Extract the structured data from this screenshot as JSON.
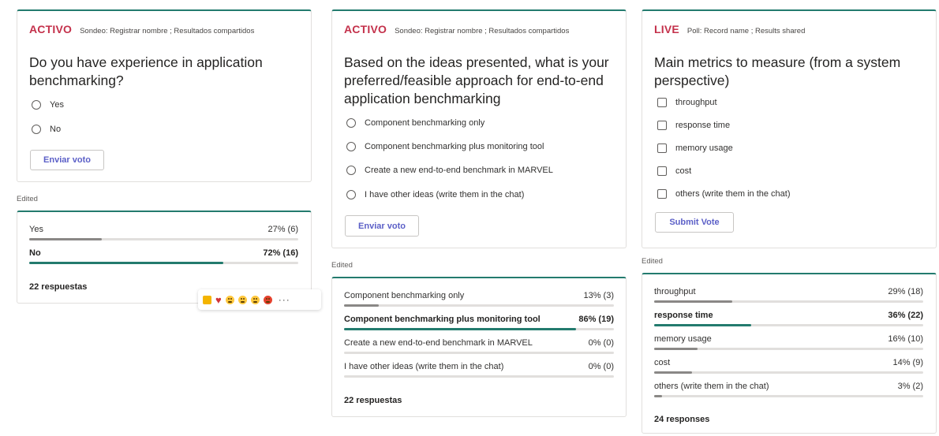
{
  "colors": {
    "live_status": "#c4314b",
    "accent_teal": "#237b6e",
    "button_text": "#5b5fc7",
    "bar_other": "#8a8886"
  },
  "poll1": {
    "status": "ACTIVO",
    "subtitle": "Sondeo: Registrar nombre ; Resultados compartidos",
    "question": "Do you have experience in application benchmarking?",
    "options": [
      "Yes",
      "No"
    ],
    "submit_label": "Enviar voto",
    "edited_label": "Edited",
    "results": [
      {
        "label": "Yes",
        "pct_text": "27% (6)",
        "fraction": 0.27,
        "leading": false
      },
      {
        "label": "No",
        "pct_text": "72% (16)",
        "fraction": 0.72,
        "leading": true
      }
    ],
    "responses": "22 respuestas",
    "reactions": [
      "like-icon",
      "heart-icon",
      "laugh-icon",
      "surprised-icon",
      "sad-icon",
      "angry-icon",
      "more-options-icon"
    ],
    "more_glyph": "···"
  },
  "poll2": {
    "status": "ACTIVO",
    "subtitle": "Sondeo: Registrar nombre ; Resultados compartidos",
    "question": "Based on the ideas presented, what is your preferred/feasible approach for end-to-end application benchmarking",
    "options": [
      "Component benchmarking only",
      "Component benchmarking plus monitoring tool",
      "Create a new end-to-end benchmark in MARVEL",
      "I have other ideas (write them in the chat)"
    ],
    "submit_label": "Enviar voto",
    "edited_label": "Edited",
    "results": [
      {
        "label": "Component benchmarking only",
        "pct_text": "13% (3)",
        "fraction": 0.13,
        "leading": false
      },
      {
        "label": "Component benchmarking plus monitoring tool",
        "pct_text": "86% (19)",
        "fraction": 0.86,
        "leading": true
      },
      {
        "label": "Create a new end-to-end benchmark in MARVEL",
        "pct_text": "0% (0)",
        "fraction": 0.0,
        "leading": false
      },
      {
        "label": "I have other ideas (write them in the chat)",
        "pct_text": "0% (0)",
        "fraction": 0.0,
        "leading": false
      }
    ],
    "responses": "22 respuestas"
  },
  "poll3": {
    "status": "LIVE",
    "subtitle": "Poll: Record name ; Results shared",
    "question": "Main metrics to measure (from a system perspective)",
    "options": [
      "throughput",
      "response time",
      "memory usage",
      "cost",
      "others (write them in the chat)"
    ],
    "submit_label": "Submit Vote",
    "edited_label": "Edited",
    "results": [
      {
        "label": "throughput",
        "pct_text": "29% (18)",
        "fraction": 0.29,
        "leading": false
      },
      {
        "label": "response time",
        "pct_text": "36% (22)",
        "fraction": 0.36,
        "leading": true
      },
      {
        "label": "memory usage",
        "pct_text": "16% (10)",
        "fraction": 0.16,
        "leading": false
      },
      {
        "label": "cost",
        "pct_text": "14% (9)",
        "fraction": 0.14,
        "leading": false
      },
      {
        "label": "others (write them in the chat)",
        "pct_text": "3% (2)",
        "fraction": 0.03,
        "leading": false
      }
    ],
    "responses": "24 responses"
  }
}
